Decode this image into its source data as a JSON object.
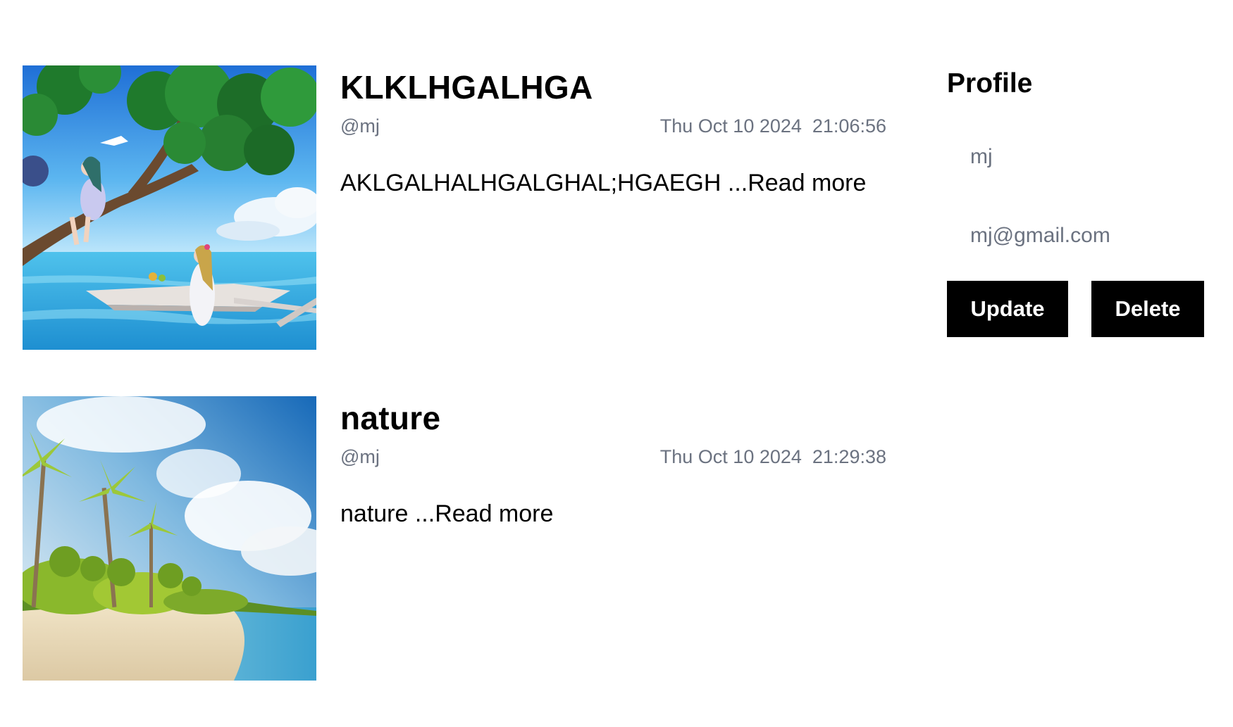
{
  "posts": [
    {
      "title": "KLKLHGALHGA",
      "author": "@mj",
      "date": "Thu Oct 10 2024  21:06:56",
      "excerpt": "AKLGALHALHGALGHAL;HGAEGH",
      "read_more": "...Read more",
      "image": "anime-girls-by-sea-illustration"
    },
    {
      "title": "nature",
      "author": "@mj",
      "date": "Thu Oct 10 2024  21:29:38",
      "excerpt": "nature",
      "read_more": "...Read more",
      "image": "tropical-beach-palm-trees-photo"
    }
  ],
  "profile": {
    "title": "Profile",
    "name_value": "mj",
    "email_value": "mj@gmail.com",
    "update_label": "Update",
    "delete_label": "Delete"
  }
}
